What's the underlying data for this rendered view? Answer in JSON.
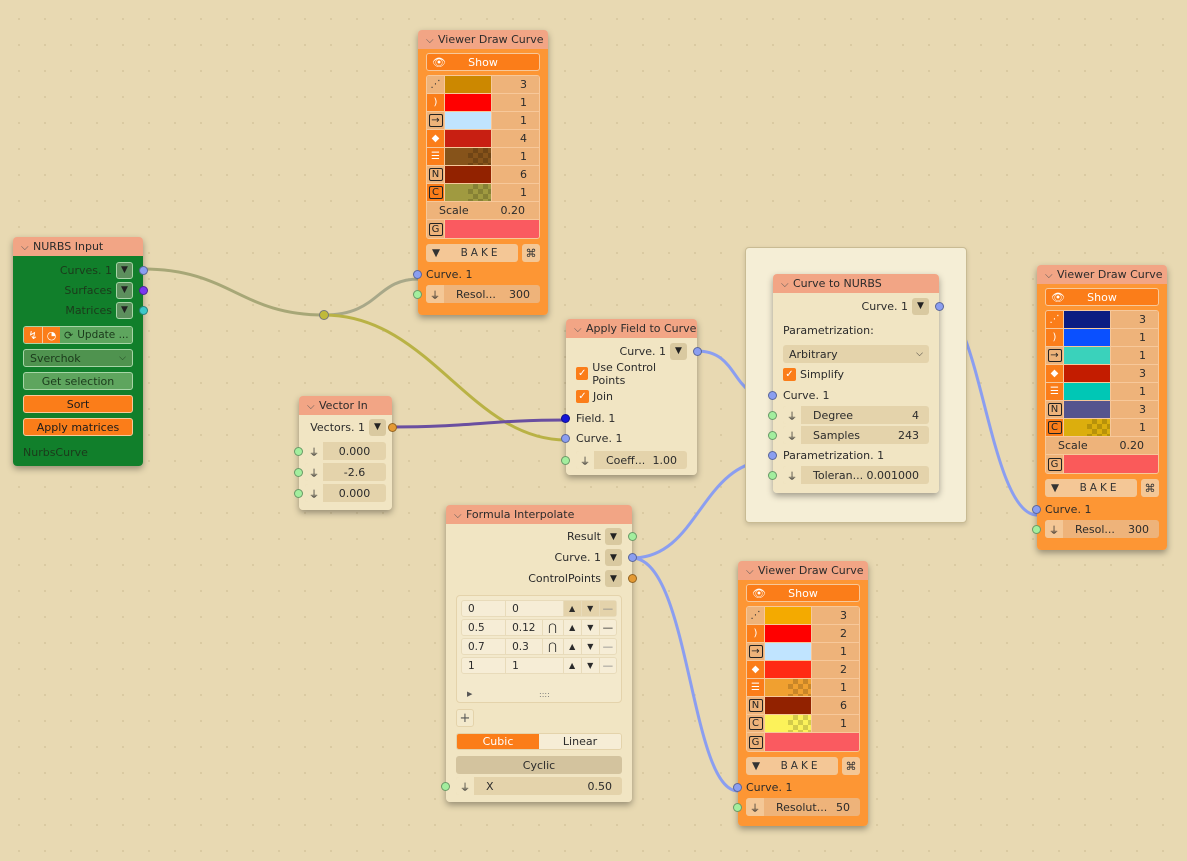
{
  "nodes": {
    "nurbs_input": {
      "title": "NURBS Input",
      "outputs": [
        "Curves. 1",
        "Surfaces",
        "Matrices"
      ],
      "update_label": "Update ...",
      "dropdown_value": "Sverchok",
      "get_selection_label": "Get selection",
      "sort_label": "Sort",
      "apply_matrices_label": "Apply matrices",
      "footer_text": "NurbsCurve"
    },
    "viewer_top": {
      "title": "Viewer Draw Curve",
      "show_label": "Show",
      "rows": [
        {
          "icon": "vertex-icon",
          "color": "#cc8800",
          "checker": false,
          "value": "3"
        },
        {
          "icon": "edge-icon",
          "color": "#ff0000",
          "checker": false,
          "value": "1"
        },
        {
          "icon": "arrow-icon",
          "color": "#c0e4ff",
          "checker": false,
          "value": "1"
        },
        {
          "icon": "diamond-icon",
          "color": "#c81f12",
          "checker": false,
          "value": "4"
        },
        {
          "icon": "lines-icon",
          "color": "#86531a",
          "checker": true,
          "value": "1"
        },
        {
          "icon": "N",
          "color": "#922200",
          "checker": false,
          "value": "6"
        },
        {
          "icon": "C",
          "color": "#a09a40",
          "checker": true,
          "value": "1"
        }
      ],
      "scale_label": "Scale",
      "scale_value": "0.20",
      "g_color": "#fa5a60",
      "bake_label": "BAKE",
      "input_curve": "Curve. 1",
      "resolution_label": "Resol...",
      "resolution_value": "300"
    },
    "vector_in": {
      "title": "Vector In",
      "output": "Vectors. 1",
      "values": [
        "0.000",
        "-2.6",
        "0.000"
      ]
    },
    "apply_field": {
      "title": "Apply Field to Curve",
      "output": "Curve. 1",
      "use_control_points_label": "Use Control Points",
      "use_control_points": true,
      "join_label": "Join",
      "join": true,
      "inputs": [
        "Field. 1",
        "Curve. 1"
      ],
      "coeff_label": "Coeff...",
      "coeff_value": "1.00"
    },
    "curve_to_nurbs": {
      "title": "Curve to NURBS",
      "output": "Curve. 1",
      "parametrization_label": "Parametrization:",
      "parametrization_value": "Arbitrary",
      "simplify_label": "Simplify",
      "simplify": true,
      "input_curve": "Curve. 1",
      "degree_label": "Degree",
      "degree_value": "4",
      "samples_label": "Samples",
      "samples_value": "243",
      "param_input": "Parametrization. 1",
      "tolerance_label": "Toleran...",
      "tolerance_value": "0.001000"
    },
    "viewer_right": {
      "title": "Viewer Draw Curve",
      "show_label": "Show",
      "rows": [
        {
          "icon": "vertex-icon",
          "color": "#0b1c82",
          "checker": false,
          "value": "3"
        },
        {
          "icon": "edge-icon",
          "color": "#0a50ff",
          "checker": false,
          "value": "1"
        },
        {
          "icon": "arrow-icon",
          "color": "#3ad2bb",
          "checker": false,
          "value": "1"
        },
        {
          "icon": "diamond-icon",
          "color": "#c31c00",
          "checker": false,
          "value": "3"
        },
        {
          "icon": "lines-icon",
          "color": "#00c7b5",
          "checker": false,
          "value": "1"
        },
        {
          "icon": "N",
          "color": "#55548e",
          "checker": false,
          "value": "3"
        },
        {
          "icon": "C",
          "color": "#dcae0d",
          "checker": true,
          "value": "1"
        }
      ],
      "scale_label": "Scale",
      "scale_value": "0.20",
      "g_color": "#fa5a5a",
      "bake_label": "BAKE",
      "input_curve": "Curve. 1",
      "resolution_label": "Resol...",
      "resolution_value": "300"
    },
    "formula_interpolate": {
      "title": "Formula Interpolate",
      "outputs": [
        "Result",
        "Curve. 1",
        "ControlPoints"
      ],
      "control_points": [
        {
          "x": "0",
          "y": "0",
          "mode": ""
        },
        {
          "x": "0.5",
          "y": "0.12",
          "mode": "curve"
        },
        {
          "x": "0.7",
          "y": "0.3",
          "mode": "curve"
        },
        {
          "x": "1",
          "y": "1",
          "mode": ""
        }
      ],
      "add_label": "+",
      "modes": [
        "Cubic",
        "Linear"
      ],
      "active_mode": "Cubic",
      "cyclic_label": "Cyclic",
      "x_label": "X",
      "x_value": "0.50"
    },
    "viewer_bottom": {
      "title": "Viewer Draw Curve",
      "show_label": "Show",
      "rows": [
        {
          "icon": "vertex-icon",
          "color": "#f4aa00",
          "checker": false,
          "value": "3"
        },
        {
          "icon": "edge-icon",
          "color": "#ff0000",
          "checker": false,
          "value": "2"
        },
        {
          "icon": "arrow-icon",
          "color": "#c0e4ff",
          "checker": false,
          "value": "1"
        },
        {
          "icon": "diamond-icon",
          "color": "#ff2a14",
          "checker": false,
          "value": "2"
        },
        {
          "icon": "lines-icon",
          "color": "#f0a030",
          "checker": true,
          "value": "1"
        },
        {
          "icon": "N",
          "color": "#922200",
          "checker": false,
          "value": "6"
        },
        {
          "icon": "C",
          "color": "#fcf25a",
          "checker": true,
          "value": "1"
        }
      ],
      "g_color": "#fa5a60",
      "bake_label": "BAKE",
      "input_curve": "Curve. 1",
      "resolution_label": "Resolut...",
      "resolution_value": "50"
    }
  },
  "wire_colors": {
    "curve": "#8b9ef0",
    "reroute": "#c0b93a",
    "vector": "#e49a34",
    "field": "#1515d8"
  }
}
